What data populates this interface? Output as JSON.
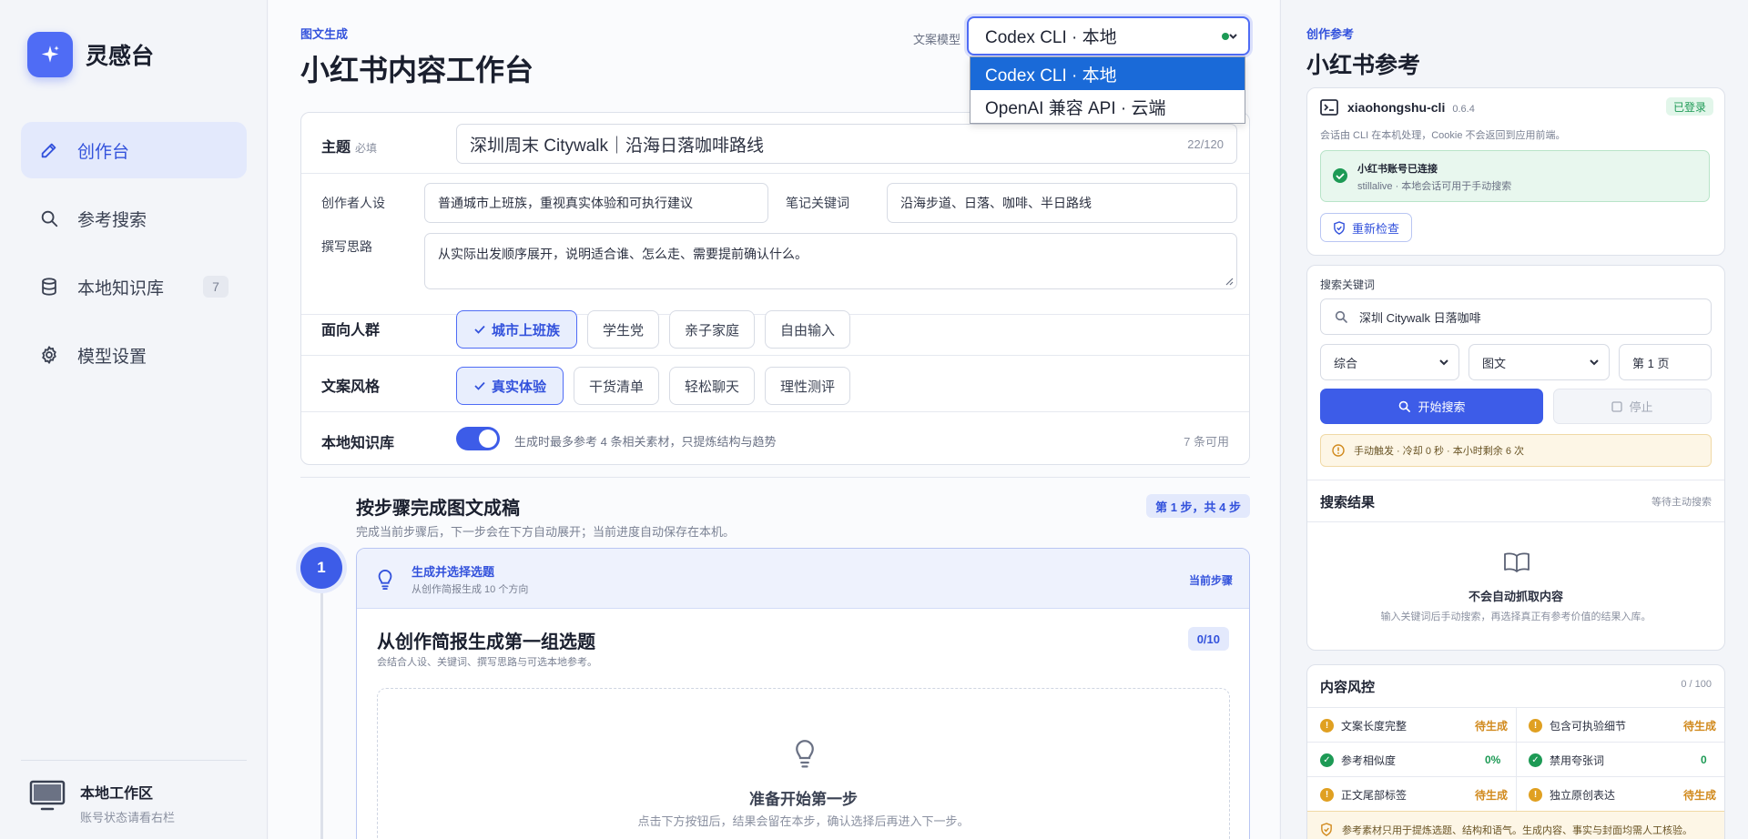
{
  "app": {
    "name": "灵感台"
  },
  "nav": {
    "items": [
      {
        "label": "创作台"
      },
      {
        "label": "参考搜索"
      },
      {
        "label": "本地知识库",
        "badge": "7"
      },
      {
        "label": "模型设置"
      }
    ]
  },
  "workspace": {
    "title": "本地工作区",
    "subtitle": "账号状态请看右栏"
  },
  "header": {
    "eyebrow": "图文生成",
    "title": "小红书内容工作台",
    "model_label": "文案模型",
    "model_selected": "Codex CLI · 本地",
    "model_options": [
      "Codex CLI · 本地",
      "OpenAI 兼容 API · 云端"
    ]
  },
  "form": {
    "topic_label": "主题",
    "topic_required": "必填",
    "topic_value": "深圳周末 Citywalk｜沿海日落咖啡路线",
    "topic_counter": "22/120",
    "persona_label": "创作者人设",
    "persona_value": "普通城市上班族，重视真实体验和可执行建议",
    "keywords_label": "笔记关键词",
    "keywords_value": "沿海步道、日落、咖啡、半日路线",
    "idea_label": "撰写思路",
    "idea_value": "从实际出发顺序展开，说明适合谁、怎么走、需要提前确认什么。",
    "audience_label": "面向人群",
    "audience_options": [
      "城市上班族",
      "学生党",
      "亲子家庭",
      "自由输入"
    ],
    "style_label": "文案风格",
    "style_options": [
      "真实体验",
      "干货清单",
      "轻松聊天",
      "理性测评"
    ],
    "kb_label": "本地知识库",
    "kb_desc": "生成时最多参考 4 条相关素材，只提炼结构与趋势",
    "kb_enabled": true,
    "kb_available": "7 条可用"
  },
  "steps": {
    "title": "按步骤完成图文成稿",
    "subtitle": "完成当前步骤后，下一步会在下方自动展开；当前进度自动保存在本机。",
    "progress": "第 1 步，共 4 步",
    "step_number": "1",
    "step_name": "生成并选择选题",
    "step_desc": "从创作简报生成 10 个方向",
    "step_status": "当前步骤",
    "card_title": "从创作简报生成第一组选题",
    "card_desc": "会结合人设、关键词、撰写思路与可选本地参考。",
    "card_count": "0/10",
    "empty_title": "准备开始第一步",
    "empty_desc": "点击下方按钮后，结果会留在本步，确认选择后再进入下一步。"
  },
  "reference": {
    "eyebrow": "创作参考",
    "title": "小红书参考",
    "cli_name": "xiaohongshu-cli",
    "cli_version": "0.6.4",
    "login_badge": "已登录",
    "cli_desc": "会话由 CLI 在本机处理，Cookie 不会返回到应用前端。",
    "account_status": "小红书账号已连接",
    "account_desc": "stillalive · 本地会话可用于手动搜索",
    "recheck_label": "重新检查",
    "search_label": "搜索关键词",
    "search_value": "深圳 Citywalk 日落咖啡",
    "sort_value": "综合",
    "type_value": "图文",
    "page_value": "第 1 页",
    "search_button": "开始搜索",
    "stop_button": "停止",
    "notice": "手动触发 · 冷却 0 秒 · 本小时剩余 6 次",
    "results_title": "搜索结果",
    "results_status": "等待主动搜索",
    "results_empty_title": "不会自动抓取内容",
    "results_empty_desc": "输入关键词后手动搜索，再选择真正有参考价值的结果入库。",
    "risk_title": "内容风控",
    "risk_count": "0 / 100",
    "risk_items": [
      {
        "label": "文案长度完整",
        "status": "待生成",
        "state": "warn"
      },
      {
        "label": "包含可执验细节",
        "status": "待生成",
        "state": "warn"
      },
      {
        "label": "参考相似度",
        "status": "0%",
        "state": "ok"
      },
      {
        "label": "禁用夸张词",
        "status": "0",
        "state": "ok"
      },
      {
        "label": "正文尾部标签",
        "status": "待生成",
        "state": "warn"
      },
      {
        "label": "独立原创表达",
        "status": "待生成",
        "state": "warn"
      }
    ],
    "footer_note": "参考素材只用于提炼选题、结构和语气。生成内容、事实与封面均需人工核验。"
  },
  "colors": {
    "accent": "#3d5ce8",
    "success": "#1d9a55",
    "warn": "#e0a021"
  }
}
